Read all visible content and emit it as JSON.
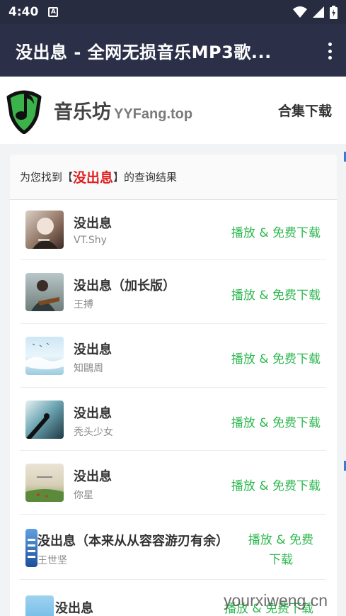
{
  "status": {
    "time": "4:40",
    "notif_icon": "A"
  },
  "appbar": {
    "title": "没出息 - 全网无损音乐MP3歌..."
  },
  "site": {
    "name": "音乐坊",
    "domain": "YYFang.top",
    "collection_link": "合集下载"
  },
  "results": {
    "prefix": "为您找到【",
    "keyword": "没出息",
    "suffix": "】的查询结果"
  },
  "songs": [
    {
      "title": "没出息",
      "artist": "VT.Shy",
      "action": "播放 & 免费下载"
    },
    {
      "title": "没出息（加长版）",
      "artist": "王搏",
      "action": "播放 & 免费下载"
    },
    {
      "title": "没出息",
      "artist": "知鷗周",
      "action": "播放 & 免费下载"
    },
    {
      "title": "没出息",
      "artist": "秃头少女",
      "action": "播放 & 免费下载"
    },
    {
      "title": "没出息",
      "artist": "你星",
      "action": "播放 & 免费下载"
    },
    {
      "title": "没出息（本来从从容容游刃有余）",
      "artist": "王世坚",
      "action_line1": "播放 & 免费",
      "action_line2": "下载"
    },
    {
      "title": "没出息",
      "artist": "",
      "action": "播放 & 免费下载"
    }
  ],
  "watermark": "yourxiweng.cn",
  "colors": {
    "appbar": "#2b3048",
    "statusbar": "#272c40",
    "keyword": "#e01e1e",
    "action": "#2eb84f"
  }
}
